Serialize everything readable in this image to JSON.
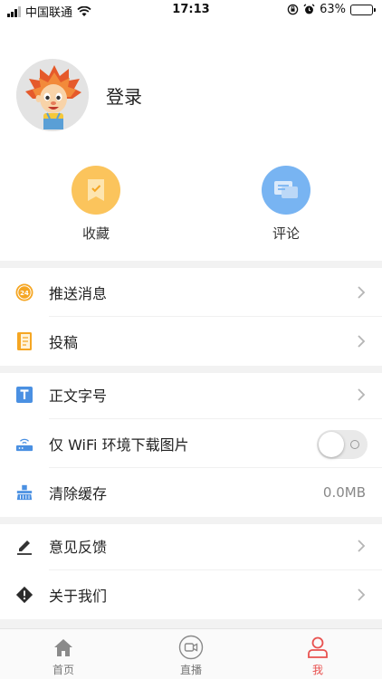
{
  "status_bar": {
    "carrier": "中国联通",
    "time": "17:13",
    "battery": "63%",
    "battery_level": 0.63
  },
  "profile": {
    "login_label": "登录"
  },
  "quick_actions": [
    {
      "label": "收藏",
      "icon": "bookmark-icon",
      "color": "#f7b445"
    },
    {
      "label": "评论",
      "icon": "comment-icon",
      "color": "#6eaef5"
    }
  ],
  "menu": {
    "push": "推送消息",
    "submit": "投稿",
    "font_size": "正文字号",
    "wifi_images": "仅 WiFi 环境下载图片",
    "wifi_images_on": false,
    "clear_cache": "清除缓存",
    "cache_size": "0.0MB",
    "feedback": "意见反馈",
    "about": "关于我们"
  },
  "tabs": [
    {
      "label": "首页",
      "icon": "home-icon",
      "active": false
    },
    {
      "label": "直播",
      "icon": "live-video-icon",
      "active": false
    },
    {
      "label": "我",
      "icon": "profile-icon",
      "active": true
    }
  ],
  "colors": {
    "accent": "#e8514f",
    "orange": "#f5a623",
    "blue": "#4a90e2"
  }
}
